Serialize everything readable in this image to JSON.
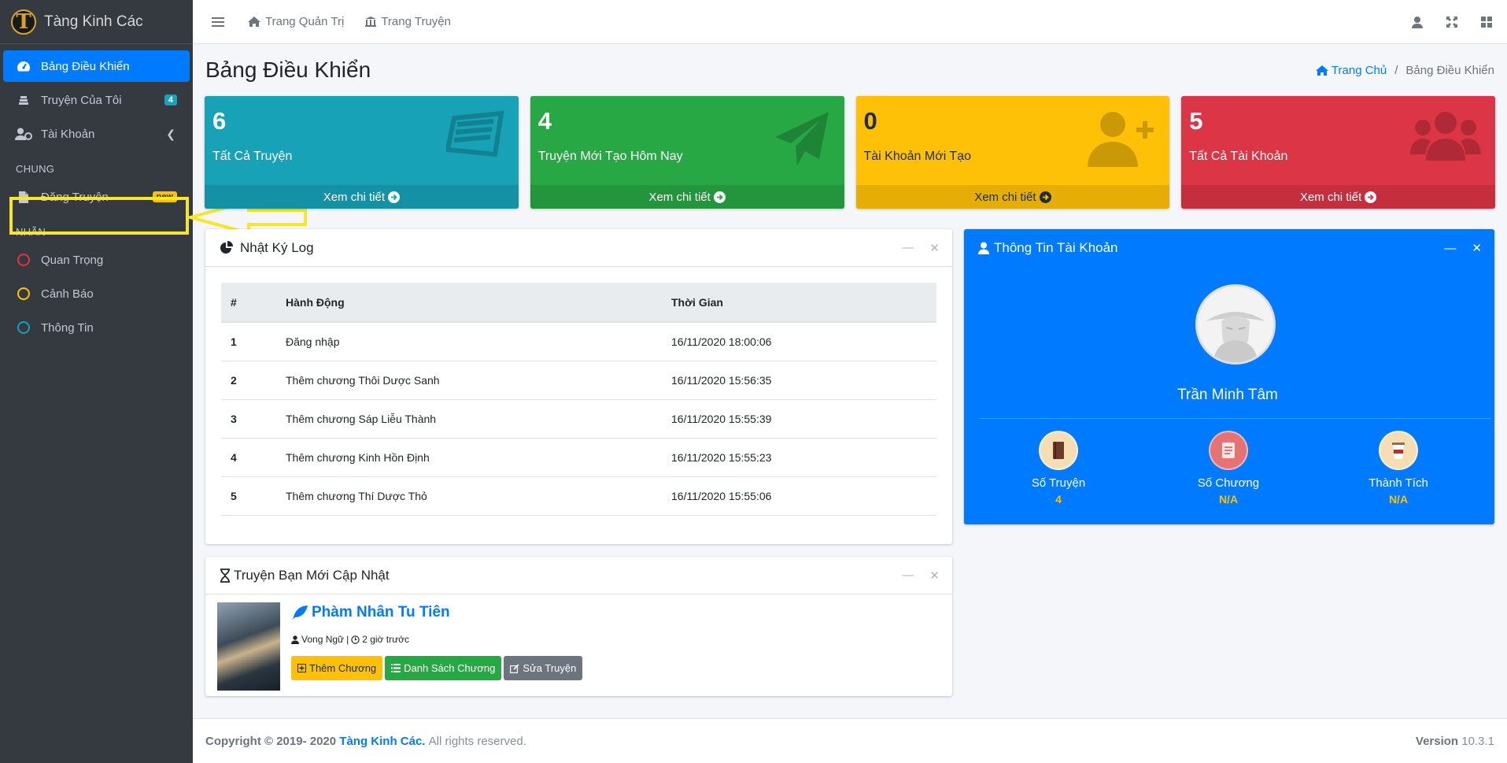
{
  "brand": {
    "name": "Tàng Kinh Các",
    "logo_letter": "T"
  },
  "sidebar": {
    "items": [
      {
        "label": "Bảng Điều Khiển",
        "icon": "dashboard-icon",
        "active": true
      },
      {
        "label": "Truyện Của Tôi",
        "icon": "books-icon",
        "badge": "4"
      },
      {
        "label": "Tài Khoản",
        "icon": "user-cog-icon"
      }
    ],
    "section_general": "CHUNG",
    "post_item": {
      "label": "Đăng Truyện",
      "icon": "file-icon",
      "badge": "new"
    },
    "section_labels": "NHÃN",
    "labels": [
      {
        "label": "Quan Trọng",
        "color": "#dc3545"
      },
      {
        "label": "Cảnh Báo",
        "color": "#ffc107"
      },
      {
        "label": "Thông Tin",
        "color": "#17a2b8"
      }
    ]
  },
  "topnav": {
    "admin": "Trang Quản Trị",
    "stories": "Trang Truyện"
  },
  "page": {
    "title": "Bảng Điều Khiển"
  },
  "breadcrumb": {
    "home": "Trang Chủ",
    "current": "Bảng Điều Khiển"
  },
  "stat_boxes": [
    {
      "value": "6",
      "label": "Tất Cả Truyện",
      "more": "Xem chi tiết",
      "color": "#17a2b8",
      "icon": "mail-icon"
    },
    {
      "value": "4",
      "label": "Truyện Mới Tạo Hôm Nay",
      "more": "Xem chi tiết",
      "color": "#28a745",
      "icon": "paper-plane-icon"
    },
    {
      "value": "0",
      "label": "Tài Khoản Mới Tạo",
      "more": "Xem chi tiết",
      "color": "#ffc107",
      "icon": "user-plus-icon"
    },
    {
      "value": "5",
      "label": "Tất Cả Tài Khoản",
      "more": "Xem chi tiết",
      "color": "#dc3545",
      "icon": "users-icon"
    }
  ],
  "log": {
    "title": "Nhật Ký Log",
    "columns": [
      "#",
      "Hành Động",
      "Thời Gian"
    ],
    "rows": [
      [
        "1",
        "Đăng nhập",
        "16/11/2020 18:00:06"
      ],
      [
        "2",
        "Thêm chương Thôi Dược Sanh",
        "16/11/2020 15:56:35"
      ],
      [
        "3",
        "Thêm chương Sáp Liễu Thành",
        "16/11/2020 15:55:39"
      ],
      [
        "4",
        "Thêm chương Kinh Hồn Định",
        "16/11/2020 15:55:23"
      ],
      [
        "5",
        "Thêm chương Thí Dược Thỏ",
        "16/11/2020 15:55:06"
      ]
    ]
  },
  "account": {
    "title": "Thông Tin Tài Khoản",
    "name": "Trần Minh Tâm",
    "stats": [
      {
        "label": "Số Truyện",
        "value": "4"
      },
      {
        "label": "Số Chương",
        "value": "N/A"
      },
      {
        "label": "Thành Tích",
        "value": "N/A"
      }
    ]
  },
  "recent": {
    "title": "Truyện Bạn Mới Cập Nhật",
    "story_title": "Phàm Nhân Tu Tiên",
    "author": "Vong Ngữ",
    "sep": "|",
    "time": "2 giờ trước",
    "buttons": {
      "add": "Thêm Chương",
      "list": "Danh Sách Chương",
      "edit": "Sửa Truyện"
    }
  },
  "footer": {
    "copyright": "Copyright © 2019- 2020",
    "brand": "Tàng Kinh Các.",
    "rights": "All rights reserved.",
    "version_label": "Version",
    "version": "10.3.1"
  }
}
